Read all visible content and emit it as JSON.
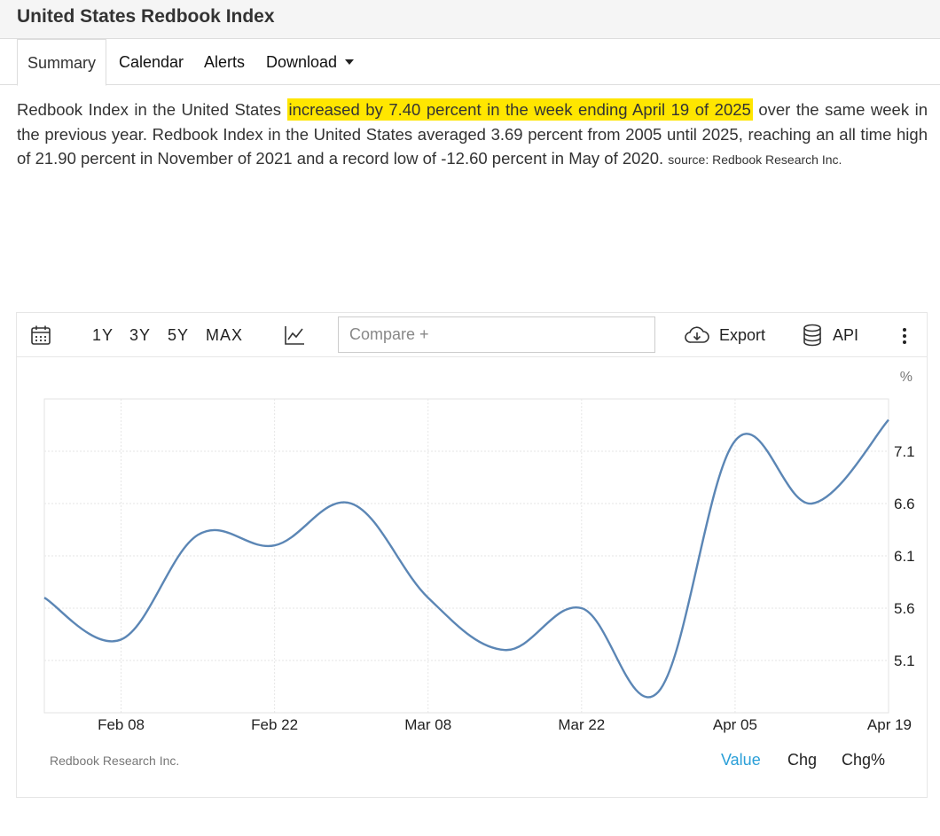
{
  "page_title": "United States Redbook Index",
  "tabs": [
    {
      "label": "Summary",
      "active": true
    },
    {
      "label": "Calendar"
    },
    {
      "label": "Alerts"
    },
    {
      "label": "Download"
    }
  ],
  "summary": {
    "pre": "Redbook Index in the United States ",
    "highlight": "increased by 7.40 percent in the week ending April 19 of 2025",
    "post": " over the same week in the previous year. Redbook Index in the United States averaged 3.69 percent from 2005 until 2025, reaching an all time high of 21.90 percent in November of 2021 and a record low of -12.60 percent in May of 2020. ",
    "source": "source: Redbook Research Inc.",
    "highlight_color": "#ffe600"
  },
  "toolbar": {
    "ranges": [
      "1Y",
      "3Y",
      "5Y",
      "MAX"
    ],
    "compare_placeholder": "Compare +",
    "export_label": "Export",
    "api_label": "API"
  },
  "footer": {
    "source": "Redbook Research Inc.",
    "tabs": [
      "Value",
      "Chg",
      "Chg%"
    ],
    "active_tab": "Value",
    "active_color": "#2a9fd8"
  },
  "chart_data": {
    "type": "line",
    "unit": "%",
    "x": [
      "Feb 01",
      "Feb 08",
      "Feb 15",
      "Feb 22",
      "Mar 01",
      "Mar 08",
      "Mar 15",
      "Mar 22",
      "Mar 29",
      "Apr 05",
      "Apr 12",
      "Apr 19"
    ],
    "x_tick_labels": [
      "Feb 08",
      "Feb 22",
      "Mar 08",
      "Mar 22",
      "Apr 05",
      "Apr 19"
    ],
    "series": [
      {
        "values": [
          5.7,
          5.3,
          6.3,
          6.2,
          6.6,
          5.7,
          5.2,
          5.6,
          4.8,
          7.2,
          6.6,
          7.4
        ],
        "color": "#5b86b5"
      }
    ],
    "y_ticks": [
      5.1,
      5.6,
      6.1,
      6.6,
      7.1
    ],
    "ylim": [
      4.6,
      7.6
    ],
    "y_axis_side": "right",
    "grid": true
  }
}
